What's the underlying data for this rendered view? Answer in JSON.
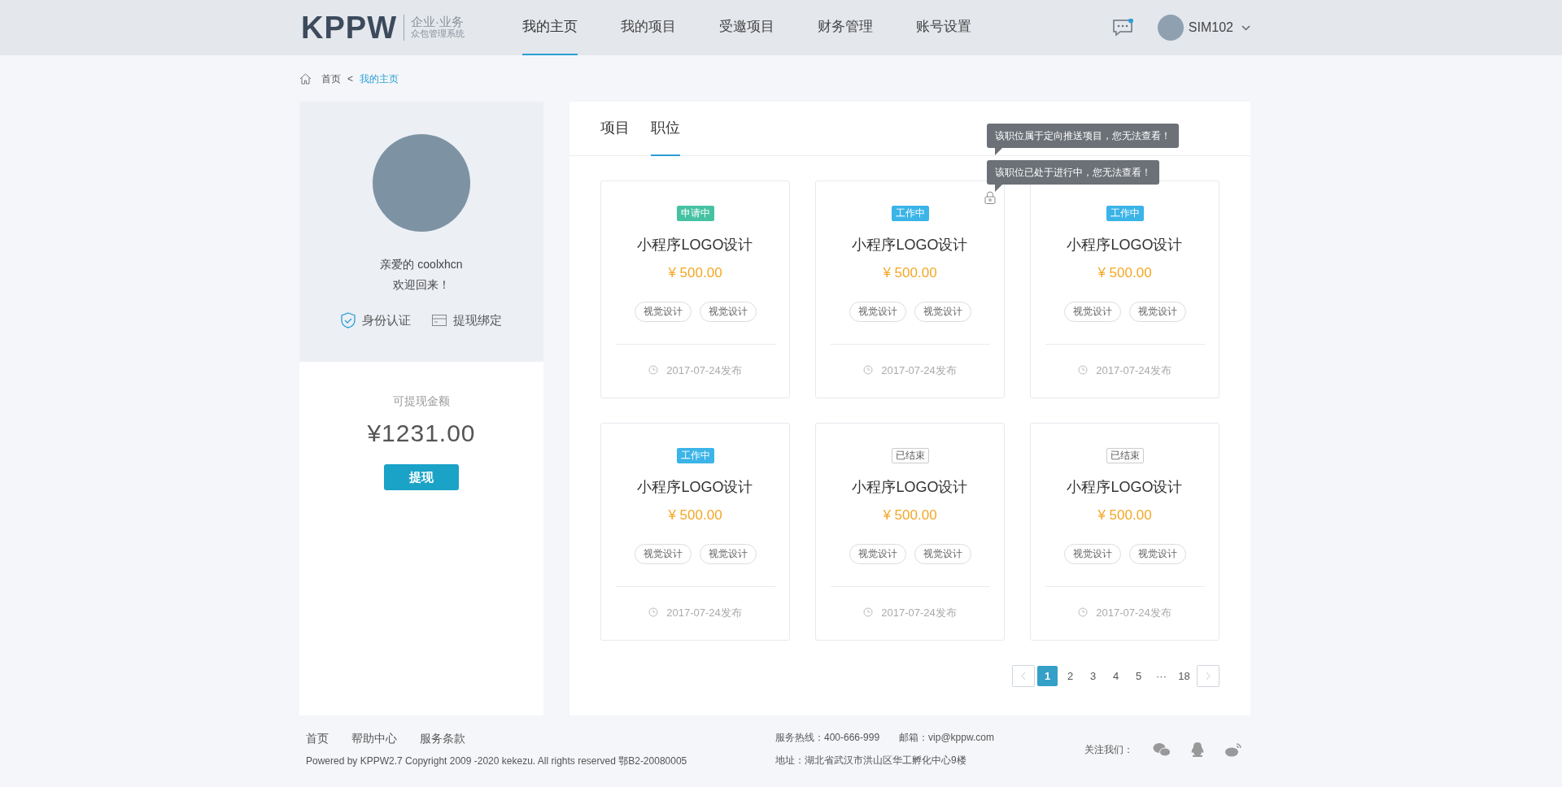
{
  "header": {
    "logo": "KPPW",
    "logo_line1": "企业·业务",
    "logo_line2": "众包管理系统",
    "nav": [
      {
        "label": "我的主页",
        "selected": true
      },
      {
        "label": "我的项目",
        "selected": false
      },
      {
        "label": "受邀项目",
        "selected": false
      },
      {
        "label": "财务管理",
        "selected": false
      },
      {
        "label": "账号设置",
        "selected": false
      }
    ],
    "messages_unread": true,
    "username": "SIM102"
  },
  "breadcrumb": {
    "home": "首页",
    "separator": "<",
    "current": "我的主页"
  },
  "profile": {
    "greeting": "亲爱的 coolxhcn",
    "welcome": "欢迎回来！",
    "links": [
      {
        "kind": "identity",
        "label": "身份认证"
      },
      {
        "kind": "card",
        "label": "提现绑定"
      }
    ],
    "balance_label": "可提现金额",
    "balance": "¥1231.00",
    "withdraw_button": "提现"
  },
  "tabs": [
    {
      "label": "项目",
      "selected": false
    },
    {
      "label": "职位",
      "selected": true
    }
  ],
  "tooltips": [
    "该职位属于定向推送项目，您无法查看！",
    "该职位已处于进行中，您无法查看！"
  ],
  "cards": [
    {
      "status": {
        "label": "申请中",
        "kind": "applying"
      },
      "locked": false,
      "title": "小程序LOGO设计",
      "price": "¥ 500.00",
      "tags": [
        "视觉设计",
        "视觉设计"
      ],
      "date": "2017-07-24发布"
    },
    {
      "status": {
        "label": "工作中",
        "kind": "working"
      },
      "locked": true,
      "title": "小程序LOGO设计",
      "price": "¥ 500.00",
      "tags": [
        "视觉设计",
        "视觉设计"
      ],
      "date": "2017-07-24发布"
    },
    {
      "status": {
        "label": "工作中",
        "kind": "working"
      },
      "locked": false,
      "title": "小程序LOGO设计",
      "price": "¥ 500.00",
      "tags": [
        "视觉设计",
        "视觉设计"
      ],
      "date": "2017-07-24发布"
    },
    {
      "status": {
        "label": "工作中",
        "kind": "working"
      },
      "locked": false,
      "title": "小程序LOGO设计",
      "price": "¥ 500.00",
      "tags": [
        "视觉设计",
        "视觉设计"
      ],
      "date": "2017-07-24发布"
    },
    {
      "status": {
        "label": "已结束",
        "kind": "ended"
      },
      "locked": false,
      "title": "小程序LOGO设计",
      "price": "¥ 500.00",
      "tags": [
        "视觉设计",
        "视觉设计"
      ],
      "date": "2017-07-24发布"
    },
    {
      "status": {
        "label": "已结束",
        "kind": "ended"
      },
      "locked": false,
      "title": "小程序LOGO设计",
      "price": "¥ 500.00",
      "tags": [
        "视觉设计",
        "视觉设计"
      ],
      "date": "2017-07-24发布"
    }
  ],
  "pagination": {
    "pages": [
      {
        "label": "1",
        "selected": true
      },
      {
        "label": "2",
        "selected": false
      },
      {
        "label": "3",
        "selected": false
      },
      {
        "label": "4",
        "selected": false
      },
      {
        "label": "5",
        "selected": false
      },
      {
        "label": "···",
        "selected": false
      },
      {
        "label": "18",
        "selected": false
      }
    ]
  },
  "footer": {
    "links": [
      "首页",
      "帮助中心",
      "服务条款"
    ],
    "copyright": "Powered by KPPW2.7 Copyright  2009 -2020 kekezu. All rights reserved 鄂B2-20080005",
    "hotline": "服务热线：400-666-999",
    "email": "邮箱：vip@kppw.com",
    "address": "地址：湖北省武汉市洪山区华工孵化中心9楼",
    "follow": "关注我们："
  }
}
